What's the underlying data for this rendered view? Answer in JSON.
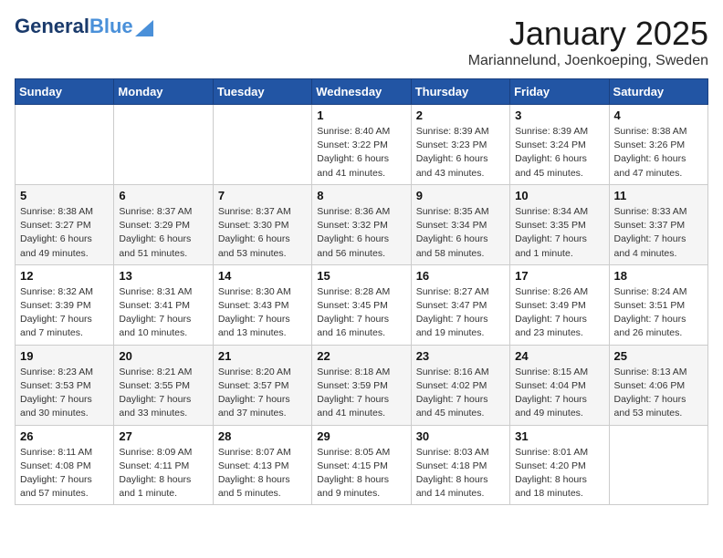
{
  "header": {
    "logo_general": "General",
    "logo_blue": "Blue",
    "month": "January 2025",
    "location": "Mariannelund, Joenkoeping, Sweden"
  },
  "days_of_week": [
    "Sunday",
    "Monday",
    "Tuesday",
    "Wednesday",
    "Thursday",
    "Friday",
    "Saturday"
  ],
  "weeks": [
    [
      {
        "day": "",
        "info": ""
      },
      {
        "day": "",
        "info": ""
      },
      {
        "day": "",
        "info": ""
      },
      {
        "day": "1",
        "info": "Sunrise: 8:40 AM\nSunset: 3:22 PM\nDaylight: 6 hours\nand 41 minutes."
      },
      {
        "day": "2",
        "info": "Sunrise: 8:39 AM\nSunset: 3:23 PM\nDaylight: 6 hours\nand 43 minutes."
      },
      {
        "day": "3",
        "info": "Sunrise: 8:39 AM\nSunset: 3:24 PM\nDaylight: 6 hours\nand 45 minutes."
      },
      {
        "day": "4",
        "info": "Sunrise: 8:38 AM\nSunset: 3:26 PM\nDaylight: 6 hours\nand 47 minutes."
      }
    ],
    [
      {
        "day": "5",
        "info": "Sunrise: 8:38 AM\nSunset: 3:27 PM\nDaylight: 6 hours\nand 49 minutes."
      },
      {
        "day": "6",
        "info": "Sunrise: 8:37 AM\nSunset: 3:29 PM\nDaylight: 6 hours\nand 51 minutes."
      },
      {
        "day": "7",
        "info": "Sunrise: 8:37 AM\nSunset: 3:30 PM\nDaylight: 6 hours\nand 53 minutes."
      },
      {
        "day": "8",
        "info": "Sunrise: 8:36 AM\nSunset: 3:32 PM\nDaylight: 6 hours\nand 56 minutes."
      },
      {
        "day": "9",
        "info": "Sunrise: 8:35 AM\nSunset: 3:34 PM\nDaylight: 6 hours\nand 58 minutes."
      },
      {
        "day": "10",
        "info": "Sunrise: 8:34 AM\nSunset: 3:35 PM\nDaylight: 7 hours\nand 1 minute."
      },
      {
        "day": "11",
        "info": "Sunrise: 8:33 AM\nSunset: 3:37 PM\nDaylight: 7 hours\nand 4 minutes."
      }
    ],
    [
      {
        "day": "12",
        "info": "Sunrise: 8:32 AM\nSunset: 3:39 PM\nDaylight: 7 hours\nand 7 minutes."
      },
      {
        "day": "13",
        "info": "Sunrise: 8:31 AM\nSunset: 3:41 PM\nDaylight: 7 hours\nand 10 minutes."
      },
      {
        "day": "14",
        "info": "Sunrise: 8:30 AM\nSunset: 3:43 PM\nDaylight: 7 hours\nand 13 minutes."
      },
      {
        "day": "15",
        "info": "Sunrise: 8:28 AM\nSunset: 3:45 PM\nDaylight: 7 hours\nand 16 minutes."
      },
      {
        "day": "16",
        "info": "Sunrise: 8:27 AM\nSunset: 3:47 PM\nDaylight: 7 hours\nand 19 minutes."
      },
      {
        "day": "17",
        "info": "Sunrise: 8:26 AM\nSunset: 3:49 PM\nDaylight: 7 hours\nand 23 minutes."
      },
      {
        "day": "18",
        "info": "Sunrise: 8:24 AM\nSunset: 3:51 PM\nDaylight: 7 hours\nand 26 minutes."
      }
    ],
    [
      {
        "day": "19",
        "info": "Sunrise: 8:23 AM\nSunset: 3:53 PM\nDaylight: 7 hours\nand 30 minutes."
      },
      {
        "day": "20",
        "info": "Sunrise: 8:21 AM\nSunset: 3:55 PM\nDaylight: 7 hours\nand 33 minutes."
      },
      {
        "day": "21",
        "info": "Sunrise: 8:20 AM\nSunset: 3:57 PM\nDaylight: 7 hours\nand 37 minutes."
      },
      {
        "day": "22",
        "info": "Sunrise: 8:18 AM\nSunset: 3:59 PM\nDaylight: 7 hours\nand 41 minutes."
      },
      {
        "day": "23",
        "info": "Sunrise: 8:16 AM\nSunset: 4:02 PM\nDaylight: 7 hours\nand 45 minutes."
      },
      {
        "day": "24",
        "info": "Sunrise: 8:15 AM\nSunset: 4:04 PM\nDaylight: 7 hours\nand 49 minutes."
      },
      {
        "day": "25",
        "info": "Sunrise: 8:13 AM\nSunset: 4:06 PM\nDaylight: 7 hours\nand 53 minutes."
      }
    ],
    [
      {
        "day": "26",
        "info": "Sunrise: 8:11 AM\nSunset: 4:08 PM\nDaylight: 7 hours\nand 57 minutes."
      },
      {
        "day": "27",
        "info": "Sunrise: 8:09 AM\nSunset: 4:11 PM\nDaylight: 8 hours\nand 1 minute."
      },
      {
        "day": "28",
        "info": "Sunrise: 8:07 AM\nSunset: 4:13 PM\nDaylight: 8 hours\nand 5 minutes."
      },
      {
        "day": "29",
        "info": "Sunrise: 8:05 AM\nSunset: 4:15 PM\nDaylight: 8 hours\nand 9 minutes."
      },
      {
        "day": "30",
        "info": "Sunrise: 8:03 AM\nSunset: 4:18 PM\nDaylight: 8 hours\nand 14 minutes."
      },
      {
        "day": "31",
        "info": "Sunrise: 8:01 AM\nSunset: 4:20 PM\nDaylight: 8 hours\nand 18 minutes."
      },
      {
        "day": "",
        "info": ""
      }
    ]
  ]
}
